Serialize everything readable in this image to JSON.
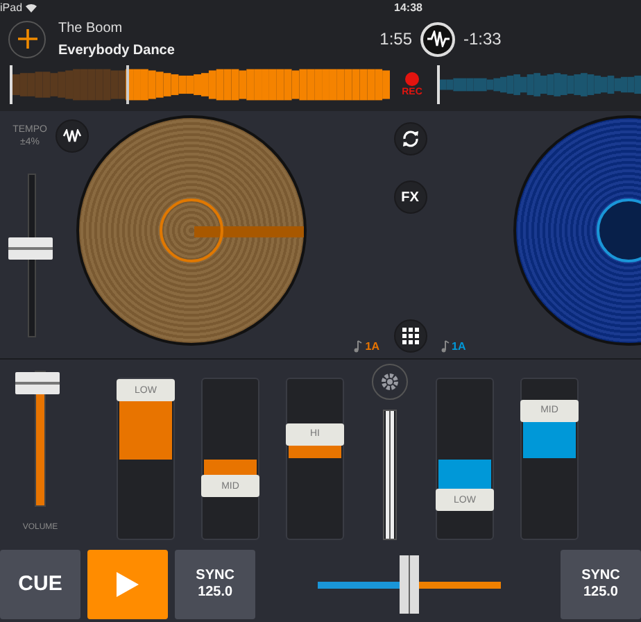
{
  "status_bar": {
    "device": "iPad",
    "time": "14:38"
  },
  "deck_a": {
    "artist": "The Boom",
    "title": "Everybody Dance",
    "elapsed": "1:55",
    "remaining": "-1:33",
    "level": 0.3,
    "key": "1A"
  },
  "rec": {
    "label": "REC",
    "on": true
  },
  "tempo": {
    "label": "TEMPO",
    "range": "±4%",
    "level": 0.55
  },
  "fx_button": "FX",
  "deck_b": {
    "key": "1A"
  },
  "volume": {
    "label": "VOLUME",
    "level": 1
  },
  "eq": [
    {
      "label": "LOW",
      "level": 1,
      "color": "#e87400"
    },
    {
      "label": "MID",
      "level": 0.3,
      "color": "#e87400"
    },
    {
      "label": "HI",
      "level": 0.68,
      "color": "#e87400"
    },
    {
      "label": "LOW",
      "level": 0.2,
      "color": "#0098d8"
    },
    {
      "label": "MID",
      "level": 0.85,
      "color": "#0098d8"
    }
  ],
  "channel_fader": {
    "level": 1
  },
  "controls": {
    "cue": "CUE",
    "play_on": true,
    "sync_a": "SYNC",
    "bpm_a": "125.0",
    "sync_b": "SYNC",
    "bpm_b": "125.0"
  },
  "crossfader": {
    "level": 0.5
  }
}
